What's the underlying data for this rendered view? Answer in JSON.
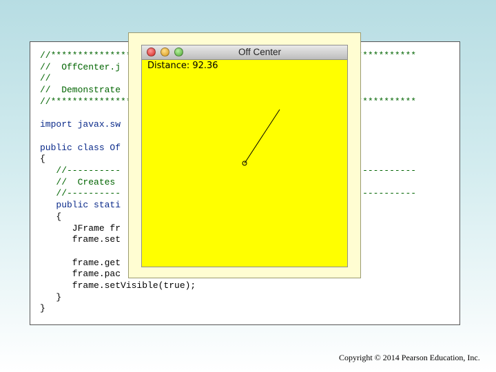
{
  "code": {
    "lines": [
      "//*****************                                  *****************",
      "//  OffCenter.j",
      "//",
      "//  Demonstrate",
      "//*****************                                  *****************",
      "import javax.sw",
      "public class Of",
      "{",
      "   //----------                                       ----------------",
      "   //  Creates",
      "   //----------                                       ----------------",
      "   public stati",
      "   {",
      "      JFrame fr",
      "      frame.set                                    SE);",
      "      frame.get",
      "      frame.pac",
      "      frame.setVisible(true);",
      "   }",
      "}"
    ]
  },
  "window": {
    "title": "Off Center",
    "distance_label": "Distance: 92.36"
  },
  "drawing": {
    "background_color": "#ffff00",
    "line_color": "#000000"
  },
  "footer": {
    "copyright": "Copyright © 2014 Pearson Education, Inc."
  }
}
